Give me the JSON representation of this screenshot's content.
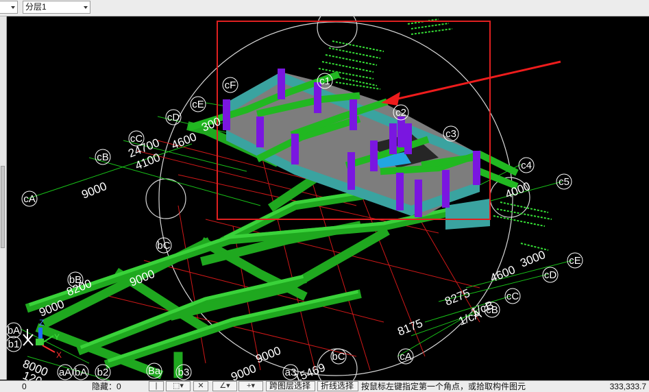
{
  "toolbar": {
    "left_dropdown": {
      "value": ""
    },
    "layer_dropdown": {
      "value": "分层1"
    }
  },
  "viewport": {
    "background": "#000000",
    "colors": {
      "beam_green": "#21b821",
      "wall_teal": "#3aa3a0",
      "wall_gray": "#7d7d7d",
      "column_purple": "#7a16e0",
      "axis_white": "#ffffff",
      "gridline_red": "#d01818",
      "gridline_green": "#18d018",
      "highlight_box": "#e02020",
      "arrow_red": "#ee1c1c"
    },
    "axis_labels": {
      "cF": "cF",
      "cE": "cE",
      "cD": "cD",
      "cC": "cC",
      "cB": "cB",
      "cA": "cA",
      "c1": "c1",
      "c2": "c2",
      "c3": "c3",
      "c4": "c4",
      "c5": "c5",
      "bC": "bC",
      "bB": "bB",
      "bA": "bA",
      "b1": "b1",
      "b2": "b2",
      "b3": "b3",
      "aA": "aA",
      "bA2": "bA",
      "a3": "a3",
      "cE_r": "cE",
      "cD_r": "cD",
      "cC_r": "cC",
      "cB_r": "cB",
      "cA_b": "cA",
      "bC_b": "bC",
      "Ba": "Ba"
    },
    "dimensions": {
      "d24700": "24700",
      "d4100": "4100",
      "d9000_l": "9000",
      "d4600_t": "4600",
      "d3000_t": "300",
      "d4000": "4000",
      "d9000_m": "9000",
      "d9000_bl": "9000",
      "d8000": "8000",
      "d120": "120",
      "d3000_r": "3000",
      "d4600_r": "4600",
      "d8275": "8275",
      "d1_cb": "1/cB",
      "d1_ca": "1/cA",
      "d8175": "8175",
      "d9000_b": "9000",
      "d15469": "15469",
      "d8200": "8200",
      "d9000_bb": "9000"
    },
    "axis_gizmo": {
      "x": "X",
      "y": "Y",
      "z": "Z"
    }
  },
  "statusbar": {
    "coord_left": "0",
    "hidden_label": "隐藏：0",
    "layer_select_button": "跨图层选择",
    "polyline_select_button": "折线选择",
    "prompt": "按鼠标左键指定第一个角点，或拾取构件图元",
    "coord_right": "333,333.7"
  }
}
